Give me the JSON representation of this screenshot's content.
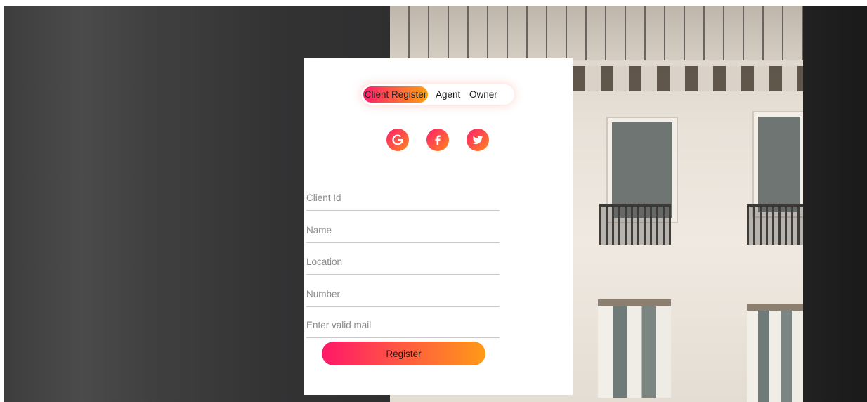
{
  "tabs": {
    "client": "Client Register",
    "agent": "Agent",
    "owner": "Owner"
  },
  "social": [
    {
      "name": "google",
      "icon": "google-icon"
    },
    {
      "name": "facebook",
      "icon": "facebook-icon"
    },
    {
      "name": "twitter",
      "icon": "twitter-icon"
    }
  ],
  "form": {
    "client_id_placeholder": "Client Id",
    "name_placeholder": "Name",
    "location_placeholder": "Location",
    "number_placeholder": "Number",
    "email_placeholder": "Enter valid mail",
    "register_label": "Register"
  },
  "colors": {
    "accent_start": "#ff1d6b",
    "accent_end": "#ffa00e"
  }
}
